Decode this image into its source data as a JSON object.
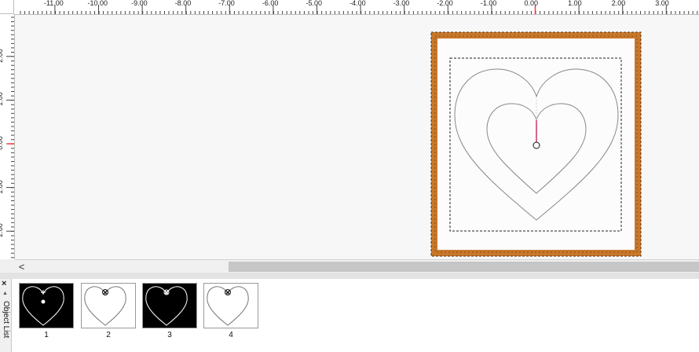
{
  "ruler": {
    "horizontal_labels": [
      "-11.00",
      "-10.00",
      "-9.00",
      "-8.00",
      "-7.00",
      "-6.00",
      "-5.00",
      "-4.00",
      "-3.00",
      "-2.00",
      "-1.00",
      "0.00",
      "1.00",
      "2.00",
      "3.00"
    ],
    "vertical_labels": [
      "2.00",
      "1.00",
      "0.00",
      "1.00",
      "2.00"
    ]
  },
  "canvas": {
    "frame_color": "#c8782a",
    "heart_color": "#888888",
    "guide_color": "#cc3366"
  },
  "scrollbar": {
    "left_arrow": "<"
  },
  "object_list": {
    "title": "Object List",
    "close_label": "×",
    "pin_label": "▲",
    "thumbnails": [
      {
        "label": "1",
        "style": "black"
      },
      {
        "label": "2",
        "style": "white"
      },
      {
        "label": "3",
        "style": "black"
      },
      {
        "label": "4",
        "style": "white"
      }
    ]
  }
}
